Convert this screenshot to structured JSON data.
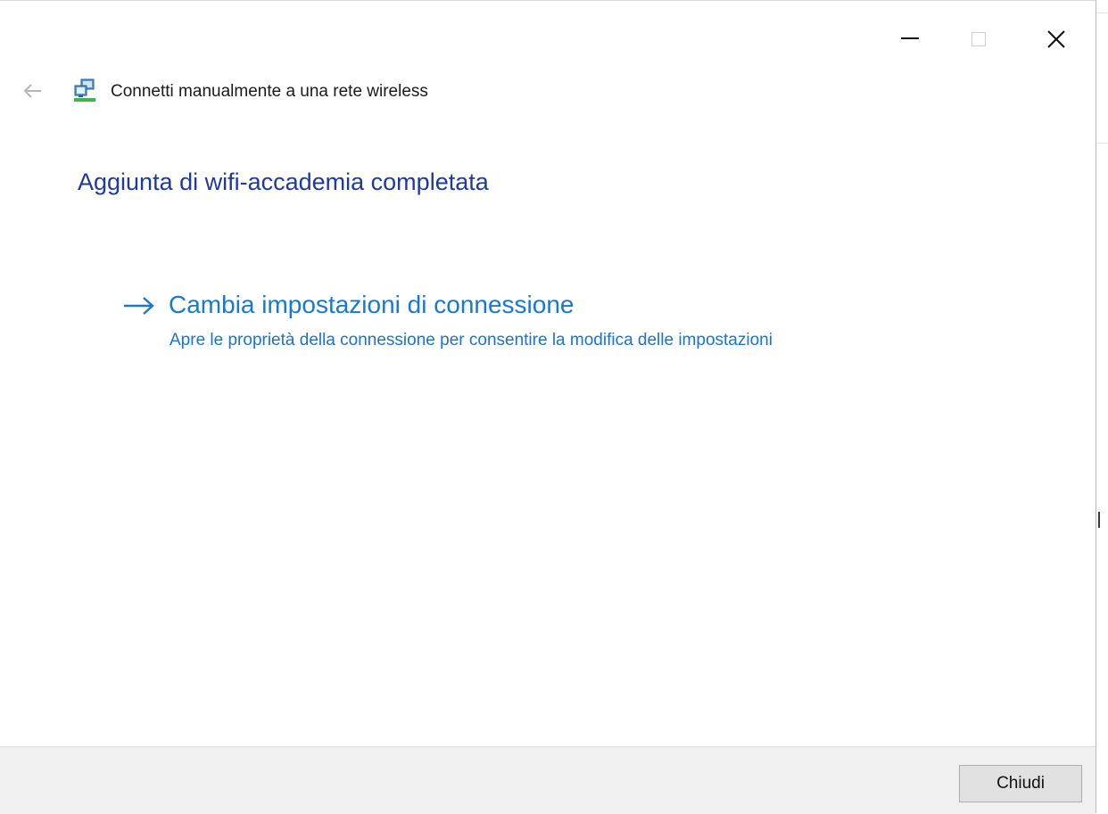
{
  "window": {
    "title": "Connetti manualmente a una rete wireless",
    "caption_buttons": {
      "minimize_icon": "minimize-icon",
      "maximize_icon": "maximize-icon",
      "close_icon": "close-icon"
    },
    "back_icon": "back-arrow-icon",
    "app_icon": "network-connection-icon"
  },
  "content": {
    "heading": "Aggiunta di wifi-accademia completata",
    "command_link": {
      "icon": "right-arrow-icon",
      "title": "Cambia impostazioni di connessione",
      "description": "Apre le proprietà della connessione per consentire la modifica delle impostazioni"
    }
  },
  "footer": {
    "close_label": "Chiudi"
  },
  "colors": {
    "heading": "#1e3a9a",
    "link": "#1979ca",
    "footer_bg": "#f0f0f0"
  }
}
